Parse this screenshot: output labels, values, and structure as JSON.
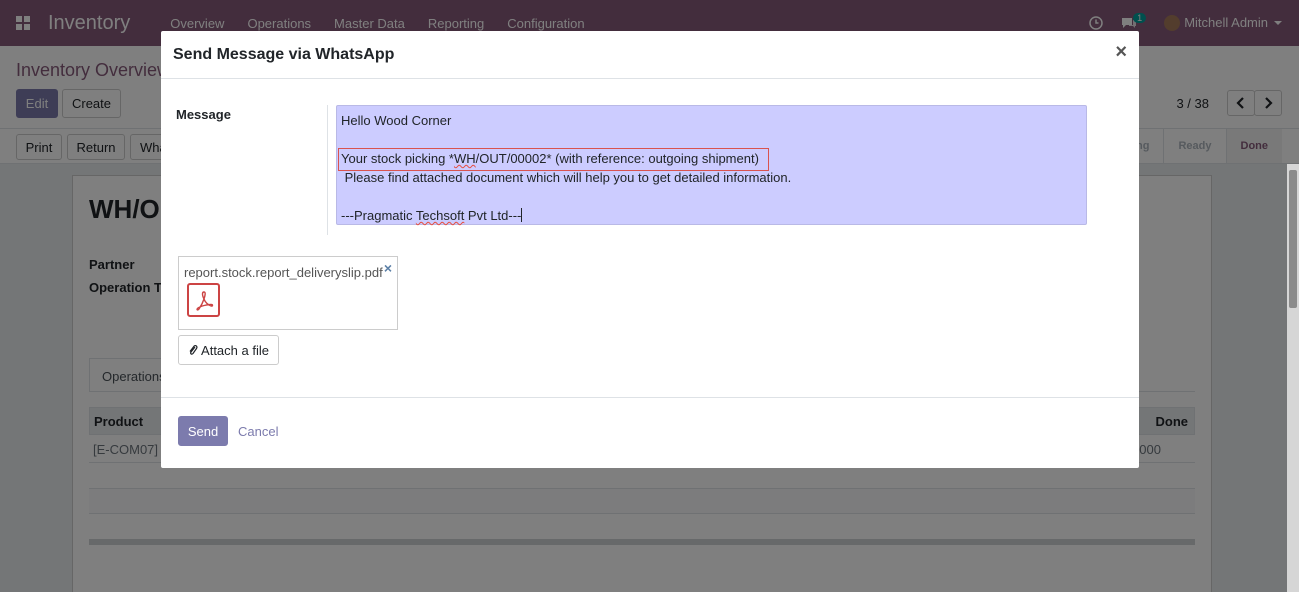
{
  "navbar": {
    "app_name": "Inventory",
    "menu": [
      "Overview",
      "Operations",
      "Master Data",
      "Reporting",
      "Configuration"
    ],
    "messages_count": "1",
    "user_name": "Mitchell Admin"
  },
  "control_panel": {
    "breadcrumb": "Inventory Overview",
    "edit_label": "Edit",
    "create_label": "Create",
    "pager": "3 / 38",
    "print_label": "Print",
    "return_label": "Return",
    "whatsapp_label": "WhatsApp",
    "status_steps": [
      "Waiting",
      "Ready",
      "Done"
    ]
  },
  "sheet": {
    "title": "WH/OUT/00002",
    "partner_label": "Partner",
    "operation_type_label": "Operation Type",
    "tab_operations": "Operations",
    "col_product": "Product",
    "col_done": "Done",
    "row_product": "[E-COM07]",
    "row_done": "1.000"
  },
  "modal": {
    "title": "Send Message via WhatsApp",
    "close_symbol": "×",
    "message_label": "Message",
    "message": {
      "line1": "Hello Wood Corner",
      "line3_prefix": "Your stock picking *",
      "line3_wh": "WH",
      "line3_suffix": "/OUT/00002* (with reference: outgoing shipment)",
      "line4": " Please find attached document which will help you to get detailed information.",
      "line6_prefix": "---Pragmatic ",
      "line6_spell": "Techsoft",
      "line6_suffix": " Pvt Ltd---"
    },
    "attachment_name": "report.stock.report_deliveryslip.pdf",
    "attachment_remove": "×",
    "attach_label": "Attach a file",
    "send_label": "Send",
    "cancel_label": "Cancel"
  },
  "colors": {
    "brand": "#875a7b",
    "primary_button": "#7c7bad",
    "message_bg": "#ccccff",
    "highlight_border": "#d9534f"
  },
  "icons": [
    "apps-grid-icon",
    "clock-icon",
    "chat-icon",
    "paperclip-icon",
    "pdf-icon",
    "chevron-left-icon",
    "chevron-right-icon",
    "whatsapp-icon"
  ]
}
